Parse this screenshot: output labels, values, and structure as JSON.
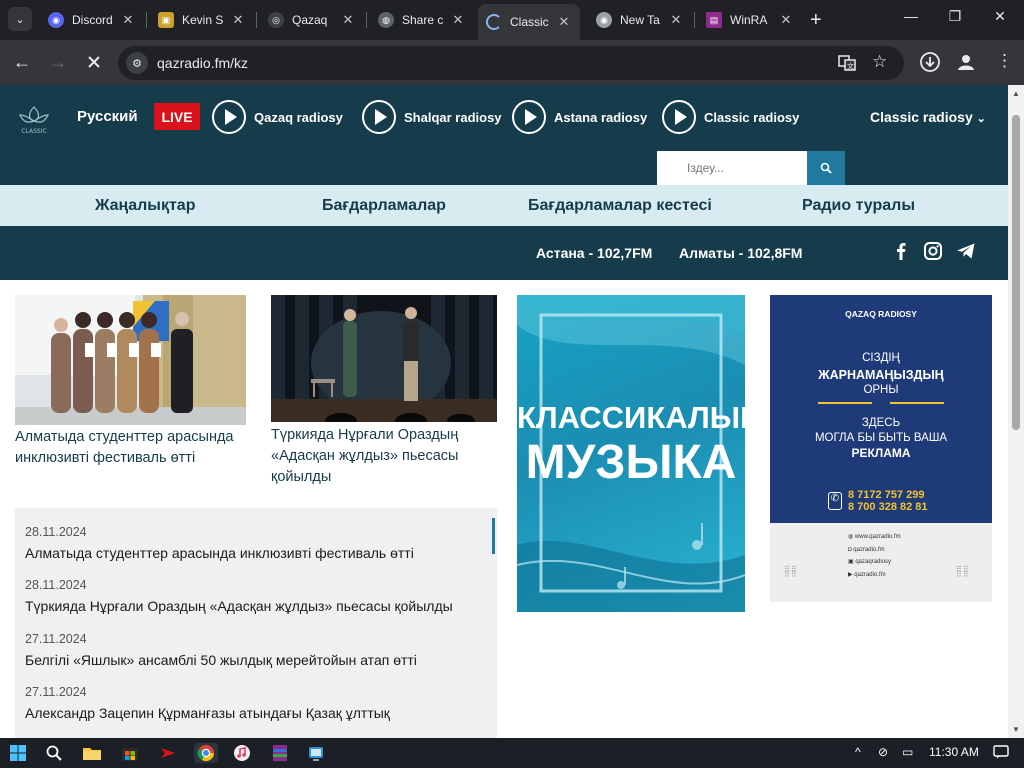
{
  "browser": {
    "tabs": [
      {
        "title": "Discord",
        "icon": "discord-icon",
        "active": false
      },
      {
        "title": "Kevin S",
        "icon": "app-icon",
        "active": false
      },
      {
        "title": "Qazaq",
        "icon": "site-icon",
        "active": false
      },
      {
        "title": "Share c",
        "icon": "globe-icon",
        "active": false
      },
      {
        "title": "Classic",
        "icon": "loading-icon",
        "active": true
      },
      {
        "title": "New Ta",
        "icon": "chrome-icon",
        "active": false
      },
      {
        "title": "WinRA",
        "icon": "winrar-icon",
        "active": false
      }
    ],
    "url": "qazradio.fm/kz"
  },
  "header": {
    "language": "Русский",
    "live_label": "LIVE",
    "radios": [
      "Qazaq radiosy",
      "Shalqar radiosy",
      "Astana radiosy",
      "Classic radiosy"
    ],
    "radio_select": "Classic radiosy",
    "search_placeholder": "Іздеу..."
  },
  "nav": [
    "Жаңалықтар",
    "Бағдарламалар",
    "Бағдарламалар кестесі",
    "Радио туралы"
  ],
  "frequencies": [
    "Астана - 102,7FM",
    "Алматы - 102,8FM"
  ],
  "news_cards": [
    {
      "title": "Алматыда студенттер арасында инклюзивті фестиваль өтті"
    },
    {
      "title": "Түркияда Нұрғали Ораздың «Адасқан жұлдыз» пьесасы қойылды"
    }
  ],
  "banner_music": {
    "line1": "КЛАССИКАЛЫҚ",
    "line2": "МУЗЫКА"
  },
  "banner_ad": {
    "brand": "QAZAQ RADIOSY",
    "kz_line1": "СІЗДІҢ",
    "kz_line2": "ЖАРНАМАҢЫЗДЫҢ",
    "kz_line3": "ОРНЫ",
    "ru_line1": "ЗДЕСЬ",
    "ru_line2": "МОГЛА БЫ БЫТЬ ВАША",
    "ru_line3": "РЕКЛАМА",
    "phone1": "8 7172 757 299",
    "phone2": "8 700 328 82 81",
    "links": [
      "www.qazradio.fm",
      "qazradio.fm",
      "qazaqradiosy",
      "qazradio.fm"
    ]
  },
  "news_list": [
    {
      "date": "28.11.2024",
      "title": "Алматыда студенттер арасында инклюзивті фестиваль өтті"
    },
    {
      "date": "28.11.2024",
      "title": "Түркияда Нұрғали Ораздың «Адасқан жұлдыз» пьесасы қойылды"
    },
    {
      "date": "27.11.2024",
      "title": "Белгілі «Яшлык» ансамблі 50 жылдық мерейтойын атап өтті"
    },
    {
      "date": "27.11.2024",
      "title": "Александр Зацепин Құрманғазы атындағы Қазақ ұлттық"
    }
  ],
  "taskbar": {
    "time": "11:30 AM"
  },
  "colors": {
    "brand_dark": "#163c4b",
    "nav_light": "#d7ebf0",
    "live_red": "#d9121b",
    "accent_blue": "#1f7a9e"
  }
}
